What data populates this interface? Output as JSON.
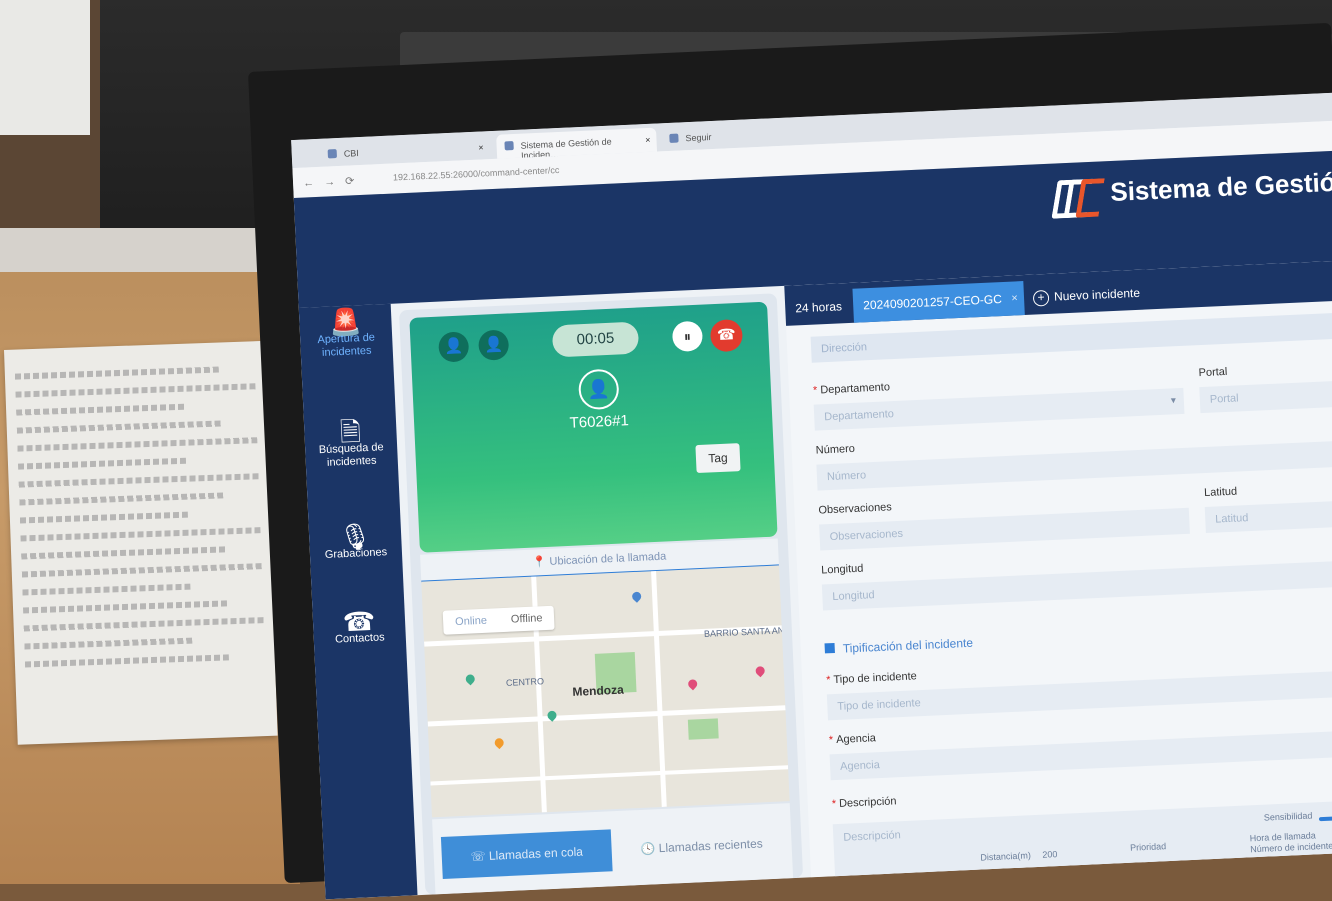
{
  "browser": {
    "tabs": [
      {
        "label": "CBI"
      },
      {
        "label": "Sistema de Gestión de Inciden…"
      },
      {
        "label": "Seguir"
      }
    ],
    "url": "192.168.22.55:26000/command-center/cc"
  },
  "app": {
    "title": "Sistema de Gestión",
    "colors": {
      "header": "#1b3566",
      "accent": "#3d8fe0",
      "call_green": "#35c07e",
      "hangup": "#e23b2e"
    }
  },
  "sidebar": {
    "items": [
      {
        "label": "Apertura de incidentes",
        "icon": "siren-icon",
        "active": true
      },
      {
        "label": "Búsqueda de incidentes",
        "icon": "document-search-icon"
      },
      {
        "label": "Grabaciones",
        "icon": "microphone-icon"
      },
      {
        "label": "Contactos",
        "icon": "phone-book-icon"
      }
    ]
  },
  "call": {
    "timer": "00:05",
    "caller_id": "T6026#1",
    "tag_label": "Tag",
    "location_label": "Ubicación de la llamada",
    "map": {
      "city": "Mendoza",
      "toggle": [
        "Online",
        "Offline"
      ],
      "labels": [
        "CENTRO",
        "BARRIO SANTA ANA"
      ]
    },
    "bottom_tabs": [
      "Llamadas en cola",
      "Llamadas recientes"
    ]
  },
  "incident": {
    "tabs": [
      "24 horas",
      "2024090201257-CEO-GC",
      "Nuevo incidente"
    ],
    "top_field": "Dirección",
    "fields": {
      "departamento": {
        "label": "Departamento",
        "placeholder": "Departamento",
        "required": true
      },
      "portal": {
        "label": "Portal",
        "placeholder": "Portal"
      },
      "numero": {
        "label": "Número",
        "placeholder": "Número"
      },
      "observaciones": {
        "label": "Observaciones",
        "placeholder": "Observaciones"
      },
      "latitud": {
        "label": "Latitud",
        "placeholder": "Latitud"
      },
      "longitud": {
        "label": "Longitud",
        "placeholder": "Longitud"
      },
      "tipo": {
        "label": "Tipo de incidente",
        "placeholder": "Tipo de incidente",
        "required": true
      },
      "agencia": {
        "label": "Agencia",
        "placeholder": "Agencia",
        "required": true
      },
      "descripcion": {
        "label": "Descripción",
        "placeholder": "Descripción",
        "required": true
      }
    },
    "section_title": "Tipificación del incidente",
    "footer": {
      "distancia_label": "Distancia(m)",
      "distancia_value": "200",
      "prioridad_label": "Prioridad",
      "sensibilidad_label": "Sensibilidad",
      "hora_label": "Hora de llamada",
      "numero_label": "Número de incidente"
    }
  }
}
